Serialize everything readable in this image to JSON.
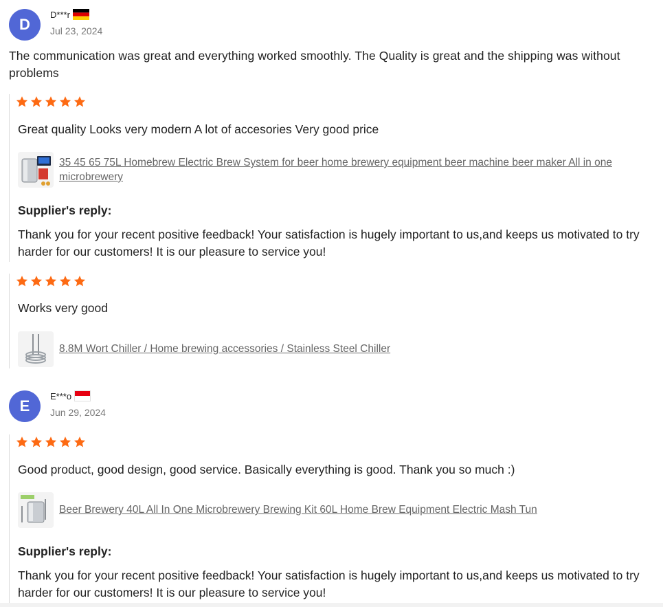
{
  "reviews": [
    {
      "avatar_letter": "D",
      "user": "D***r",
      "flag": "germany-flag",
      "date": "Jul 23, 2024",
      "text": "The communication was great and everything worked smoothly. The Quality is great and the shipping was without problems",
      "items": [
        {
          "rating": 5,
          "text": "Great quality Looks very modern A lot of accesories Very good price",
          "product": "35 45 65 75L Homebrew Electric Brew System for beer home brewery equipment beer machine beer maker All in one microbrewery",
          "thumb_icon": "brew-system-thumbnail",
          "reply_title": "Supplier's reply:",
          "reply": "Thank you for your recent positive feedback! Your satisfaction is hugely important to us,and keeps us motivated to try harder for our customers! It is our pleasure to service you!"
        },
        {
          "rating": 5,
          "text": "Works very good",
          "product": "8.8M Wort Chiller / Home brewing accessories / Stainless Steel Chiller",
          "thumb_icon": "wort-chiller-thumbnail"
        }
      ]
    },
    {
      "avatar_letter": "E",
      "user": "E***o",
      "flag": "indonesia-flag",
      "date": "Jun 29, 2024",
      "items": [
        {
          "rating": 5,
          "text": "Good product, good design, good service. Basically everything is good. Thank you so much :)",
          "product": "Beer Brewery 40L All In One Microbrewery Brewing Kit 60L Home Brew Equipment Electric Mash Tun",
          "thumb_icon": "brewery-kit-thumbnail",
          "reply_title": "Supplier's reply:",
          "reply": "Thank you for your recent positive feedback! Your satisfaction is hugely important to us,and keeps us motivated to try harder for our customers! It is our pleasure to service you!"
        }
      ]
    }
  ],
  "colors": {
    "avatar": "#5167d6",
    "star": "#fd6a13",
    "link": "#666666",
    "divider": "#dddddd"
  }
}
